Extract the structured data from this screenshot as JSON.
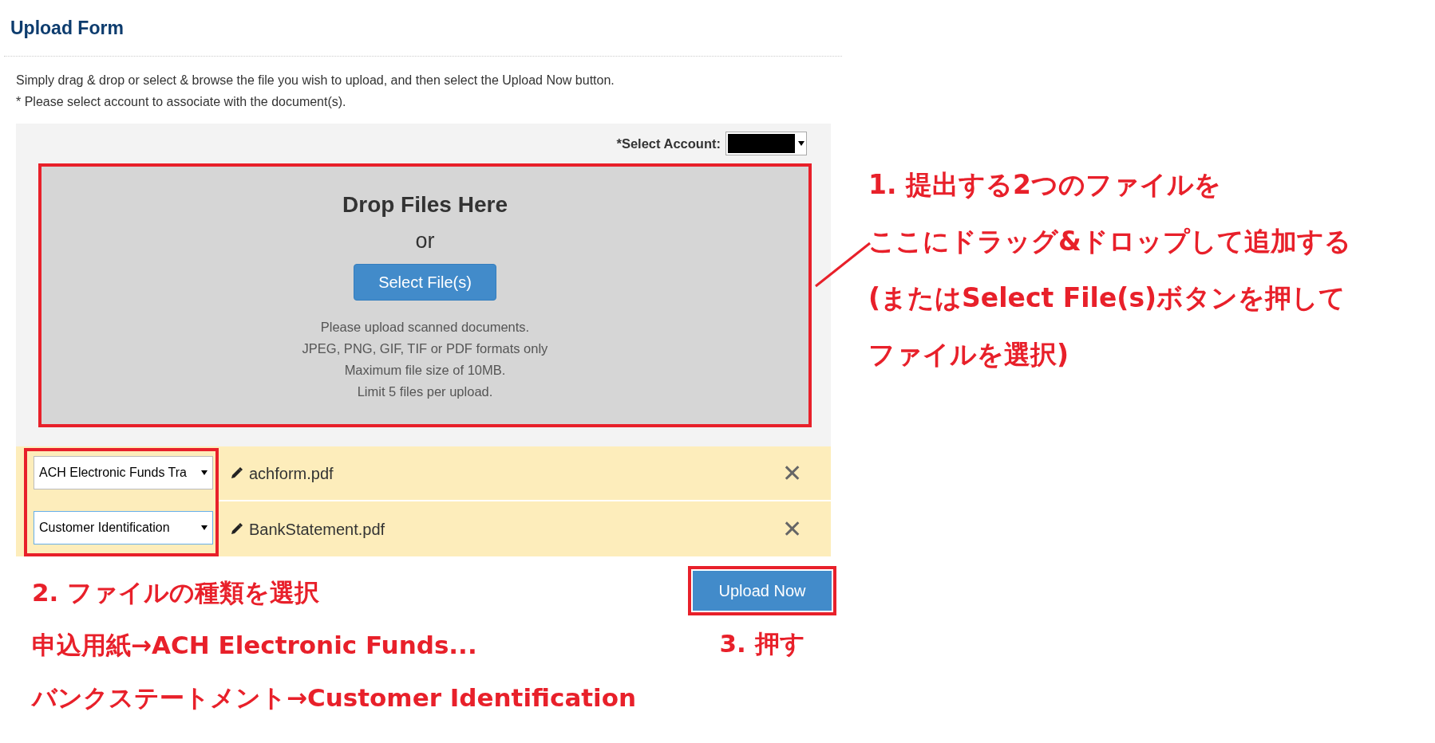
{
  "title": "Upload Form",
  "intro": [
    "Simply drag & drop or select & browse the file you wish to upload, and then select the Upload Now button.",
    "* Please select account to associate with the document(s)."
  ],
  "account": {
    "label": "*Select Account:",
    "redacted": true
  },
  "drop_zone": {
    "heading": "Drop Files Here",
    "or": "or",
    "button": "Select File(s)",
    "notes": [
      "Please upload scanned documents.",
      "JPEG, PNG, GIF, TIF or PDF formats only",
      "Maximum file size of 10MB.",
      "Limit 5 files per upload."
    ]
  },
  "files": [
    {
      "type": "ACH Electronic Funds Tra",
      "focused": false,
      "name": "achform.pdf",
      "remove": "✕"
    },
    {
      "type": "Customer Identification",
      "focused": true,
      "name": "BankStatement.pdf",
      "remove": "✕"
    }
  ],
  "upload_button": "Upload Now",
  "annotations": {
    "step1": [
      "1. 提出する2つのファイルを",
      "ここにドラッグ&ドロップして追加する",
      "(またはSelect File(s)ボタンを押して",
      "ファイルを選択)"
    ],
    "step2": [
      "2. ファイルの種類を選択",
      "申込用紙→ACH Electronic Funds...",
      "バンクステートメント→Customer Identification"
    ],
    "step3": "3. 押す"
  }
}
